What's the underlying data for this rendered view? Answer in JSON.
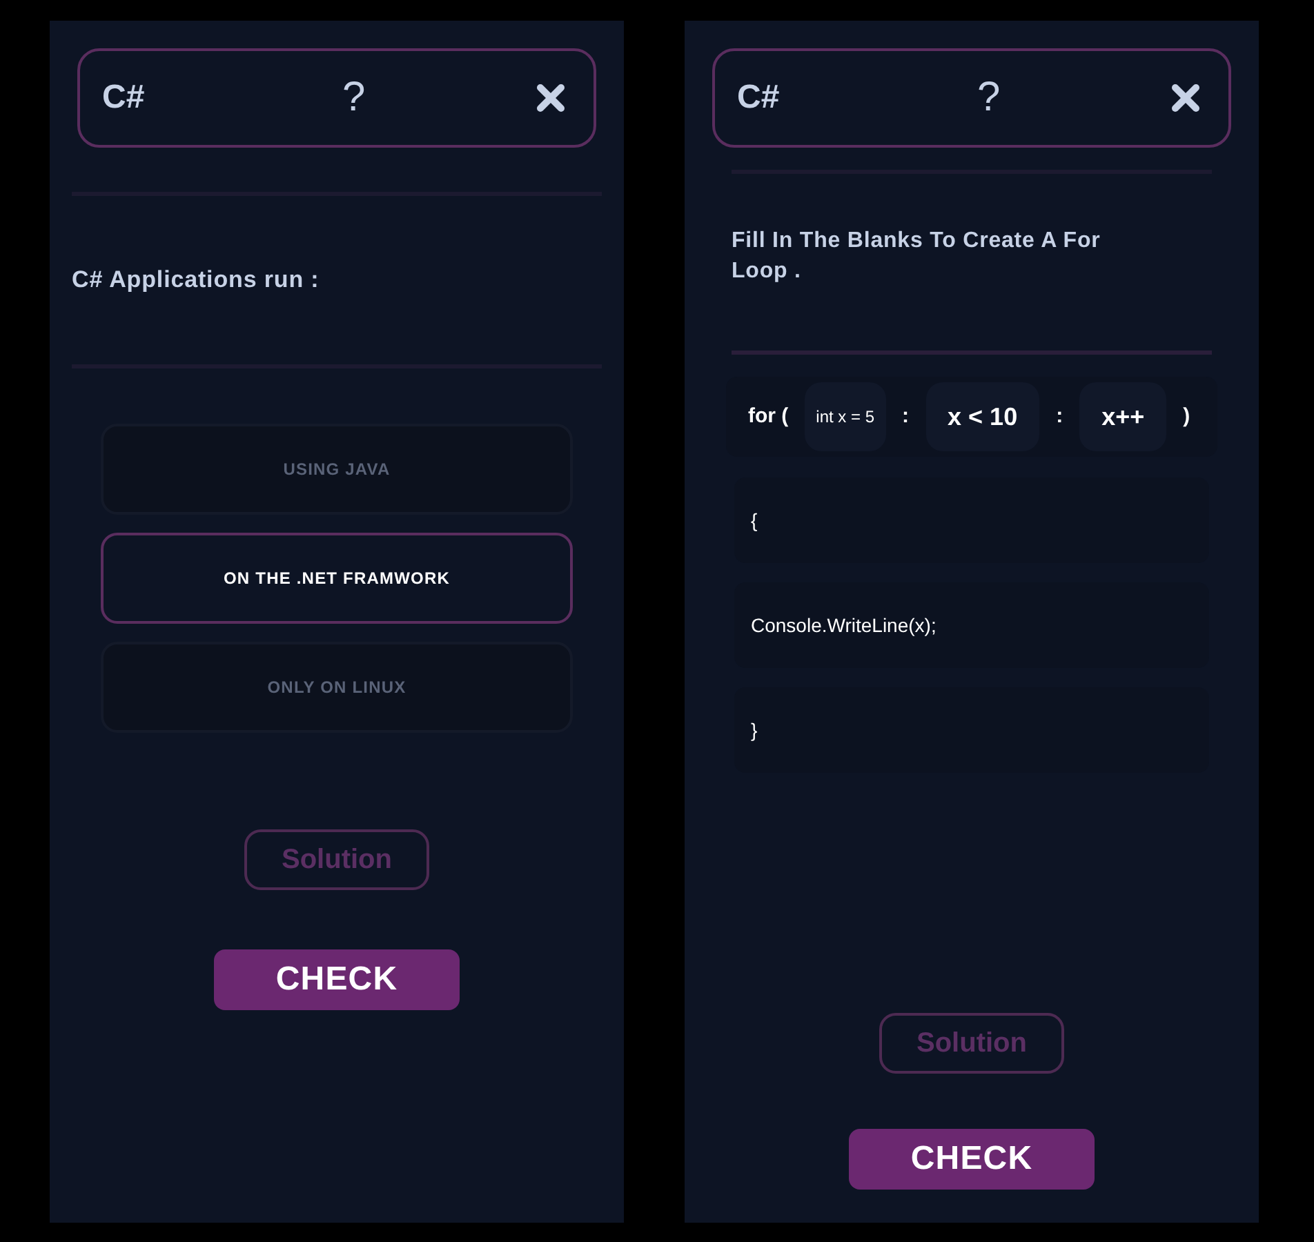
{
  "screens": [
    {
      "kind": "choice",
      "header": {
        "title": "C#",
        "help": "?"
      },
      "question": "C# Applications run :",
      "options": [
        {
          "label": "USING JAVA",
          "selected": false
        },
        {
          "label": "ON THE .NET FRAMWORK",
          "selected": true
        },
        {
          "label": "ONLY ON LINUX",
          "selected": false
        }
      ],
      "solution": "Solution",
      "check": "CHECK"
    },
    {
      "kind": "code",
      "header": {
        "title": "C#",
        "help": "?"
      },
      "question": "Fill In The Blanks To Create A For Loop .",
      "loop": [
        {
          "kind": "text",
          "text": "for ("
        },
        {
          "kind": "small_blank",
          "text": "int x = 5"
        },
        {
          "kind": "text",
          "text": ":"
        },
        {
          "kind": "blank",
          "text": "x < 10"
        },
        {
          "kind": "text",
          "text": ":"
        },
        {
          "kind": "blank",
          "text": "x++"
        },
        {
          "kind": "text",
          "text": ")"
        }
      ],
      "lines": [
        "{",
        "Console.WriteLine(x);",
        "}"
      ],
      "solution": "Solution",
      "check": "CHECK"
    }
  ]
}
